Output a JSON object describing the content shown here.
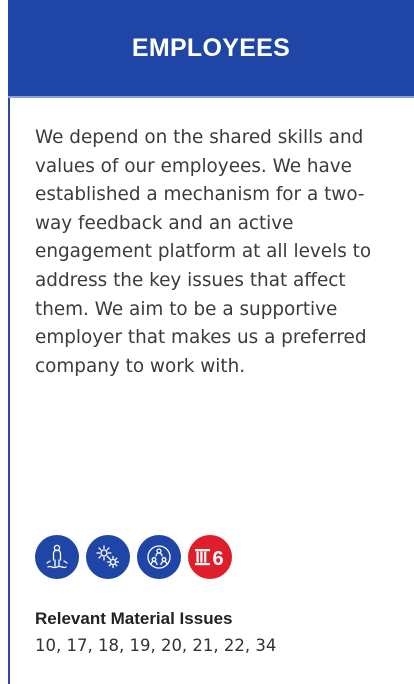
{
  "header": {
    "title": "EMPLOYEES"
  },
  "body": {
    "text": "We depend on the shared skills and values of our employees. We have established a mechanism for a two-way feedback and an active engagement platform at all levels to address the key issues that affect them. We aim to be a supportive employer that makes us a preferred company to work with."
  },
  "icons": [
    {
      "name": "person-growth-icon"
    },
    {
      "name": "gears-icon"
    },
    {
      "name": "people-network-icon"
    },
    {
      "name": "capital-pillar-icon",
      "label": "6"
    }
  ],
  "material_issues": {
    "heading": "Relevant Material Issues",
    "list": "10, 17, 18, 19, 20, 21, 22, 34"
  },
  "colors": {
    "brand_blue": "#1f46a6",
    "accent_red": "#e01d2a",
    "text": "#3b3b3b"
  }
}
